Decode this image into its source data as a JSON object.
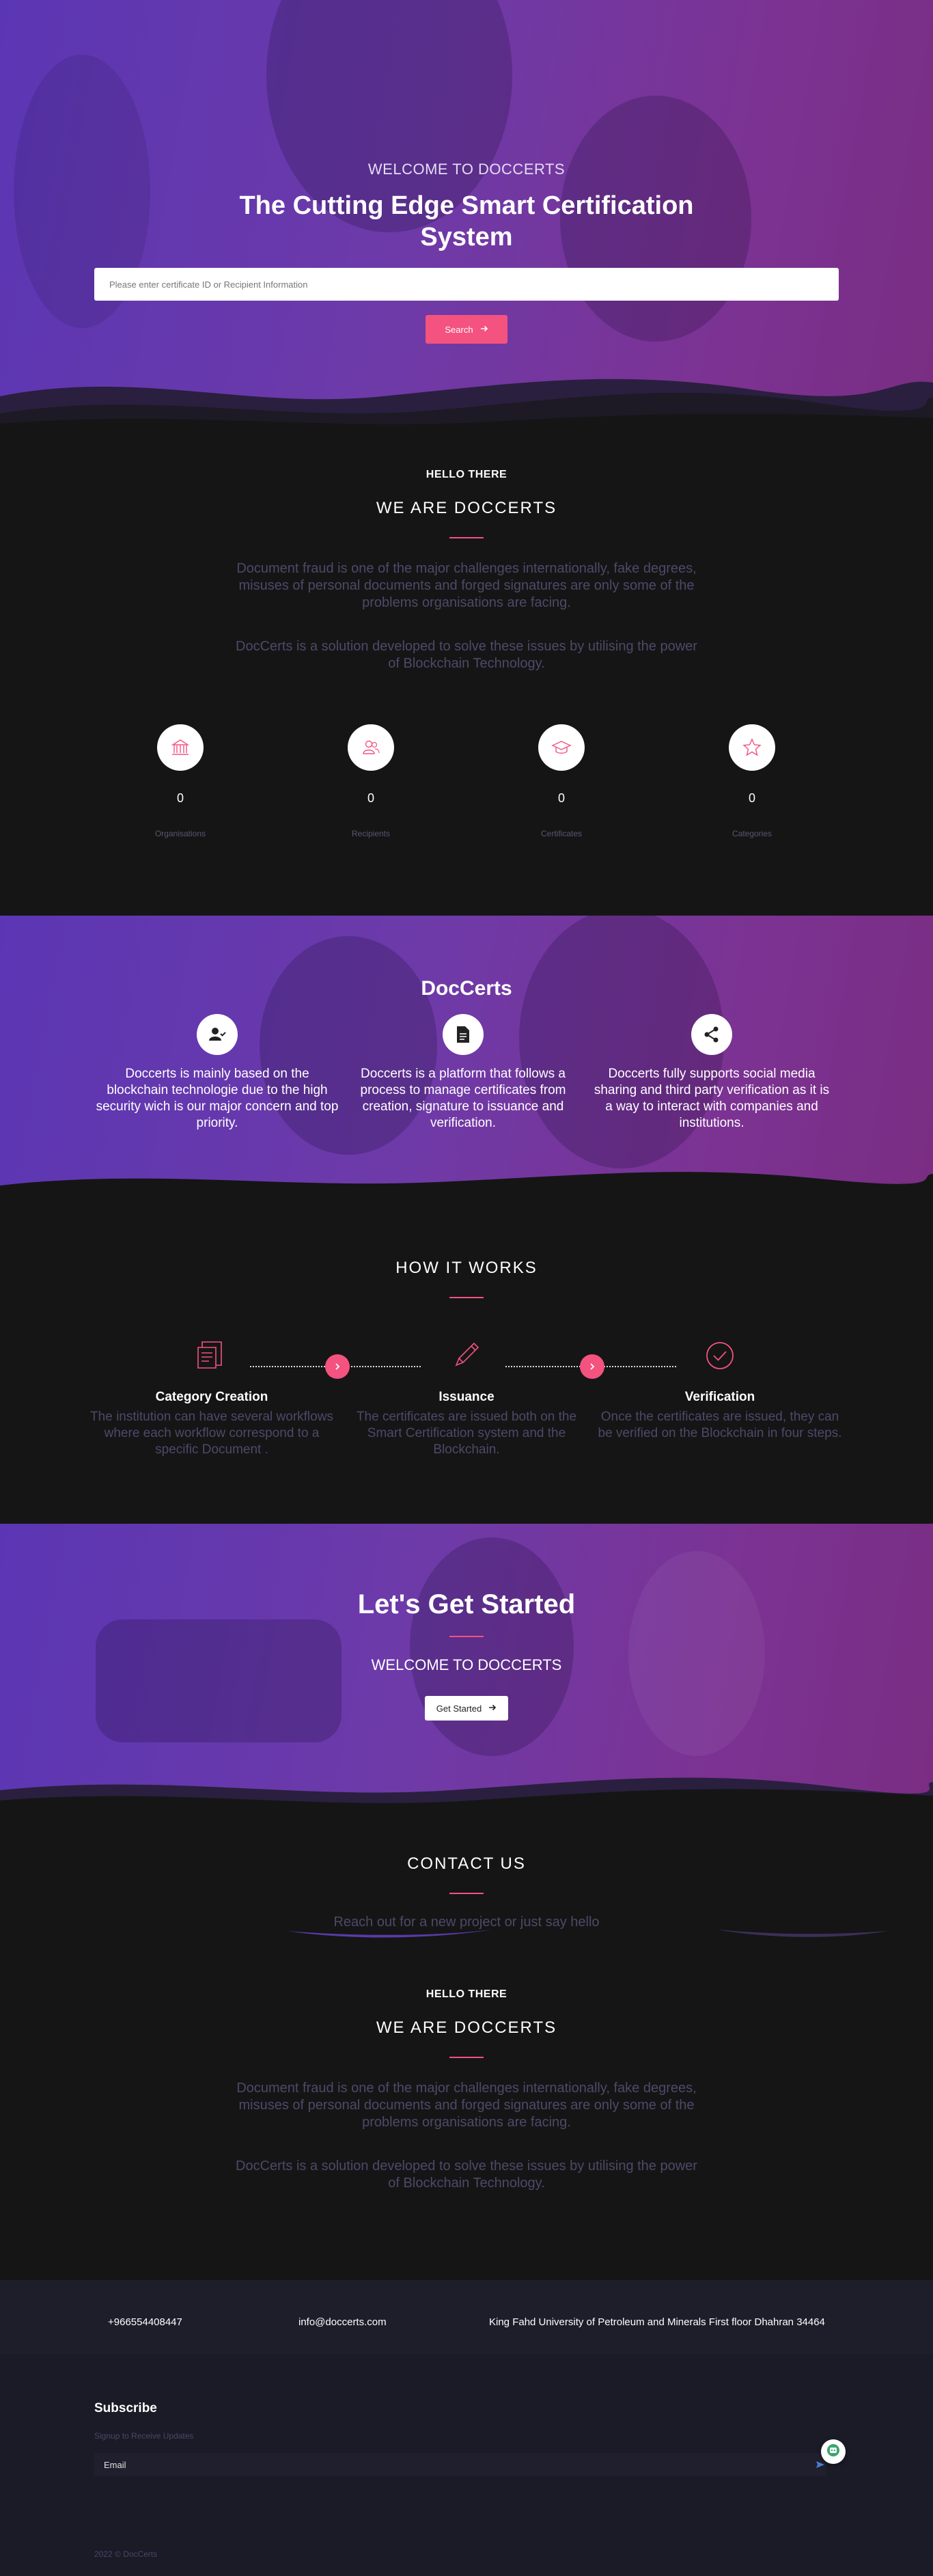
{
  "hero": {
    "welcome": "WELCOME TO DOCCERTS",
    "title": "The Cutting Edge Smart Certification System",
    "search_placeholder": "Please enter certificate ID or Recipient Information",
    "search_button": "Search"
  },
  "about": {
    "hello": "HELLO THERE",
    "heading": "WE ARE DOCCERTS",
    "para1": "Document fraud is one of the major challenges internationally, fake degrees, misuses of personal documents and forged signatures are only some of the problems organisations are facing.",
    "para2": "DocCerts is a solution developed to solve these issues by utilising the power of Blockchain Technology.",
    "stats": [
      {
        "value": "0",
        "label": "Organisations",
        "icon": "bank-icon"
      },
      {
        "value": "0",
        "label": "Recipients",
        "icon": "users-icon"
      },
      {
        "value": "0",
        "label": "Certificates",
        "icon": "graduation-cap-icon"
      },
      {
        "value": "0",
        "label": "Categories",
        "icon": "star-icon"
      }
    ]
  },
  "feature": {
    "title": "DocCerts",
    "items": [
      {
        "icon": "user-check-icon",
        "text": "Doccerts is mainly based on the blockchain technologie due to the high security wich is our major concern and top priority."
      },
      {
        "icon": "file-icon",
        "text": "Doccerts is a platform that follows a process to manage certificates from creation, signature to issuance and verification."
      },
      {
        "icon": "share-icon",
        "text": "Doccerts fully supports social media sharing and third party verification as it is a way to interact with companies and institutions."
      }
    ]
  },
  "how": {
    "title": "HOW IT WORKS",
    "steps": [
      {
        "icon": "document-list-icon",
        "title": "Category Creation",
        "text": "The institution can have several workflows where each workflow correspond to a specific Document ."
      },
      {
        "icon": "pencil-icon",
        "title": "Issuance",
        "text": "The certificates are issued both on the Smart Certification system and the Blockchain."
      },
      {
        "icon": "check-circle-icon",
        "title": "Verification",
        "text": "Once the certificates are issued, they can be verified on the Blockchain in four steps."
      }
    ]
  },
  "started": {
    "title": "Let's Get Started",
    "welcome": "WELCOME TO DOCCERTS",
    "button": "Get Started"
  },
  "contact": {
    "title": "CONTACT US",
    "subtitle": "Reach out for a new project or just say hello"
  },
  "about2": {
    "hello": "HELLO THERE",
    "heading": "WE ARE DOCCERTS",
    "para1": "Document fraud is one of the major challenges internationally, fake degrees, misuses of personal documents and forged signatures are only some of the problems organisations are facing.",
    "para2": "DocCerts is a solution developed to solve these issues by utilising the power of Blockchain Technology."
  },
  "footer": {
    "phone": "+966554408447",
    "email": "info@doccerts.com",
    "address": "King Fahd University of Petroleum and Minerals First floor Dhahran 34464",
    "subscribe_title": "Subscribe",
    "subscribe_hint": "Signup to Receive Updates",
    "email_placeholder": "Email",
    "copyright": "2022 © DocCerts"
  },
  "colors": {
    "accent": "#f4527f",
    "purple": "#6a3aae",
    "dark": "#151516",
    "muted_text": "#4e4967"
  }
}
